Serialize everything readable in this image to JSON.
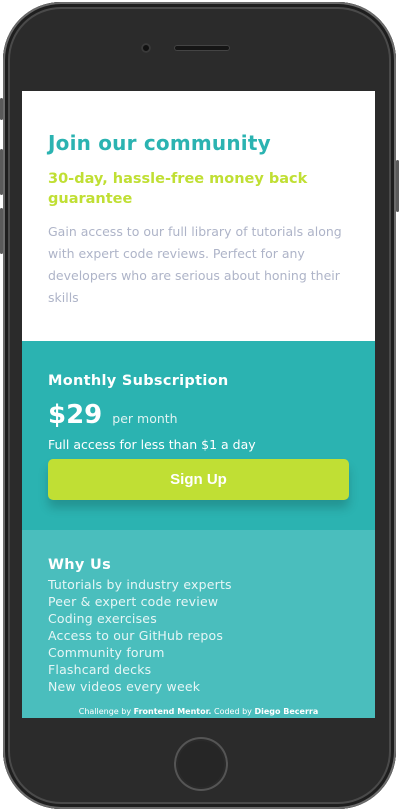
{
  "community": {
    "title": "Join our community",
    "subtitle": "30-day, hassle-free money back guarantee",
    "description": "Gain access to our full library of tutorials along with expert code reviews. Perfect for any developers who are serious about honing their skills"
  },
  "subscription": {
    "title": "Monthly Subscription",
    "price": "$29",
    "period": "per month",
    "note": "Full access for less than $1 a day",
    "cta_label": "Sign Up"
  },
  "why_us": {
    "title": "Why Us",
    "items": [
      "Tutorials by industry experts",
      "Peer & expert code review",
      "Coding exercises",
      "Access to our GitHub repos",
      "Community forum",
      "Flashcard decks",
      "New videos every week"
    ]
  },
  "attribution": {
    "prefix": "Challenge by",
    "challenge_link": "Frontend Mentor.",
    "middle": "Coded by",
    "author_link": "Diego Becerra"
  },
  "colors": {
    "teal": "#2bb3b1",
    "light_teal": "#4abebd",
    "lime": "#c0df34",
    "grey_text": "#aeb4c8"
  }
}
